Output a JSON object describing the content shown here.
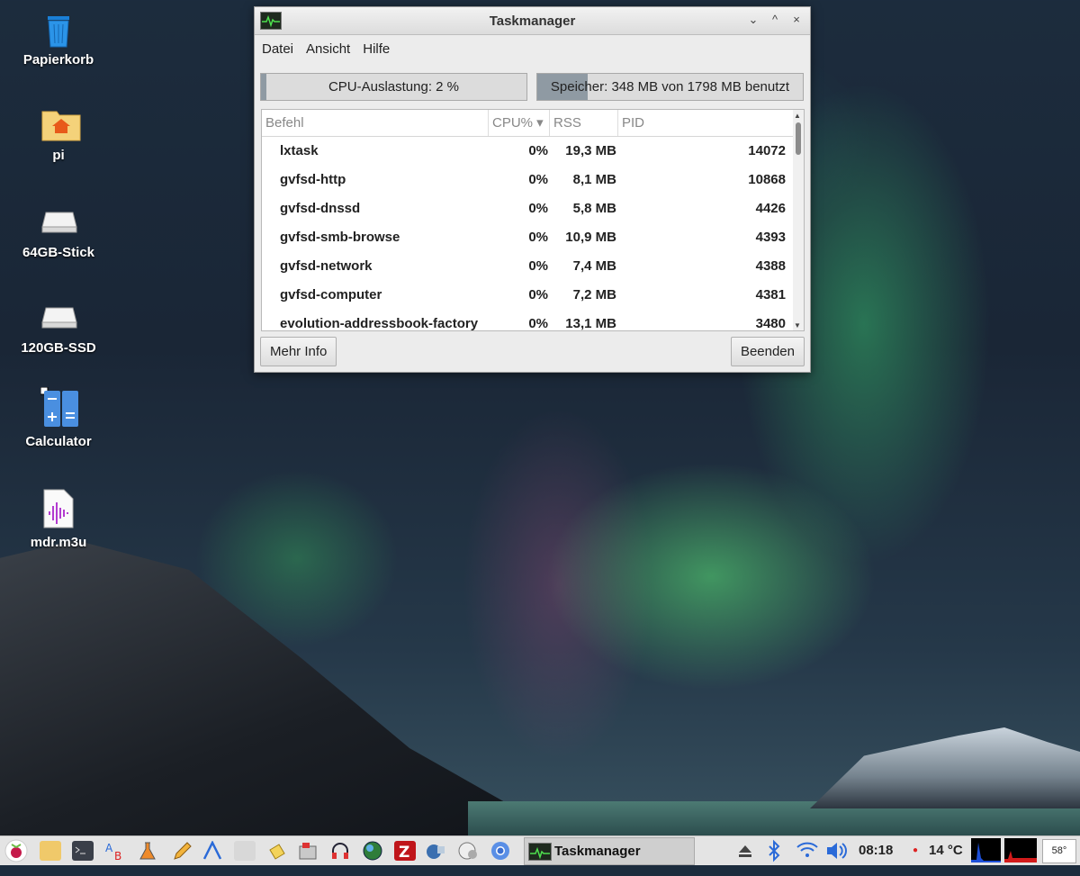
{
  "desktop": {
    "icons": [
      {
        "label": "Papierkorb",
        "icon": "trash-icon"
      },
      {
        "label": "pi",
        "icon": "home-folder-icon"
      },
      {
        "label": "64GB-Stick",
        "icon": "drive-icon"
      },
      {
        "label": "120GB-SSD",
        "icon": "drive-icon"
      },
      {
        "label": "Calculator",
        "icon": "calculator-icon"
      },
      {
        "label": "mdr.m3u",
        "icon": "audio-file-icon"
      }
    ]
  },
  "window": {
    "title": "Taskmanager",
    "controls": {
      "minimize": "⌄",
      "maximize": "^",
      "close": "×"
    },
    "menu": [
      "Datei",
      "Ansicht",
      "Hilfe"
    ],
    "cpu_meter": {
      "label": "CPU-Auslastung: 2 %",
      "fraction": 0.02
    },
    "mem_meter": {
      "label": "Speicher: 348 MB von 1798 MB benutzt",
      "fraction": 0.19
    },
    "columns": {
      "command": "Befehl",
      "cpu": "CPU% ▾",
      "rss": "RSS",
      "pid": "PID"
    },
    "processes": [
      {
        "command": "lxtask",
        "cpu": "0%",
        "rss": "19,3 MB",
        "pid": "14072"
      },
      {
        "command": "gvfsd-http",
        "cpu": "0%",
        "rss": "8,1 MB",
        "pid": "10868"
      },
      {
        "command": "gvfsd-dnssd",
        "cpu": "0%",
        "rss": "5,8 MB",
        "pid": "4426"
      },
      {
        "command": "gvfsd-smb-browse",
        "cpu": "0%",
        "rss": "10,9 MB",
        "pid": "4393"
      },
      {
        "command": "gvfsd-network",
        "cpu": "0%",
        "rss": "7,4 MB",
        "pid": "4388"
      },
      {
        "command": "gvfsd-computer",
        "cpu": "0%",
        "rss": "7,2 MB",
        "pid": "4381"
      },
      {
        "command": "evolution-addressbook-factory",
        "cpu": "0%",
        "rss": "13,1 MB",
        "pid": "3480"
      }
    ],
    "buttons": {
      "more_info": "Mehr Info",
      "quit": "Beenden"
    }
  },
  "panel": {
    "launchers": [
      "raspberry-menu-icon",
      "file-manager-icon",
      "terminal-icon",
      "font-viewer-icon",
      "science-icon",
      "pencil-icon",
      "arduino-icon",
      "archive-icon",
      "cleaner-icon",
      "package-icon",
      "headphones-icon",
      "globe-icon",
      "filezilla-icon",
      "vnc-icon",
      "mixer-icon",
      "chromium-icon"
    ],
    "taskbar_item": "Taskmanager",
    "clock": "08:18",
    "temperature": "14 °C",
    "cpu_temp": "58°",
    "colors": {
      "accent": "#2a6ad8",
      "panel": "#e4e4e4",
      "filezilla": "#c0151a"
    }
  }
}
